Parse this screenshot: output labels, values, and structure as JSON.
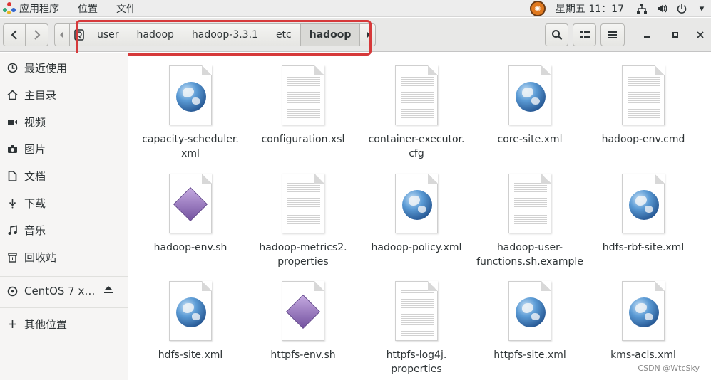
{
  "topbar": {
    "menu": [
      "应用程序",
      "位置",
      "文件"
    ],
    "clock": "星期五 11：17",
    "tray": {
      "network_icon": "network-icon",
      "volume_icon": "volume-icon",
      "power_icon": "power-icon"
    }
  },
  "toolbar": {
    "back_icon": "‹",
    "forward_icon": "›",
    "path": [
      "user",
      "hadoop",
      "hadoop-3.3.1",
      "etc",
      "hadoop"
    ],
    "active_index": 4,
    "highlight_color": "#d6393a"
  },
  "sidebar": {
    "items": [
      {
        "label": "最近使用",
        "icon": "clock-icon"
      },
      {
        "label": "主目录",
        "icon": "home-icon"
      },
      {
        "label": "视频",
        "icon": "video-icon"
      },
      {
        "label": "图片",
        "icon": "camera-icon"
      },
      {
        "label": "文档",
        "icon": "document-icon"
      },
      {
        "label": "下载",
        "icon": "download-icon"
      },
      {
        "label": "音乐",
        "icon": "music-icon"
      },
      {
        "label": "回收站",
        "icon": "trash-icon"
      }
    ],
    "device": {
      "label": "CentOS 7 x…",
      "icon": "disc-icon"
    },
    "other": {
      "label": "其他位置",
      "icon": "plus-icon"
    }
  },
  "files": [
    {
      "name": "capacity-scheduler.\nxml",
      "type": "xml"
    },
    {
      "name": "configuration.xsl",
      "type": "text"
    },
    {
      "name": "container-executor.\ncfg",
      "type": "text"
    },
    {
      "name": "core-site.xml",
      "type": "xml"
    },
    {
      "name": "hadoop-env.cmd",
      "type": "text"
    },
    {
      "name": "hadoop-env.sh",
      "type": "script"
    },
    {
      "name": "hadoop-metrics2.\nproperties",
      "type": "text"
    },
    {
      "name": "hadoop-policy.xml",
      "type": "xml"
    },
    {
      "name": "hadoop-user-\nfunctions.sh.example",
      "type": "text"
    },
    {
      "name": "hdfs-rbf-site.xml",
      "type": "xml"
    },
    {
      "name": "hdfs-site.xml",
      "type": "xml"
    },
    {
      "name": "httpfs-env.sh",
      "type": "script"
    },
    {
      "name": "httpfs-log4j.\nproperties",
      "type": "text"
    },
    {
      "name": "httpfs-site.xml",
      "type": "xml"
    },
    {
      "name": "kms-acls.xml",
      "type": "xml"
    }
  ],
  "watermark": "CSDN @WtcSky"
}
